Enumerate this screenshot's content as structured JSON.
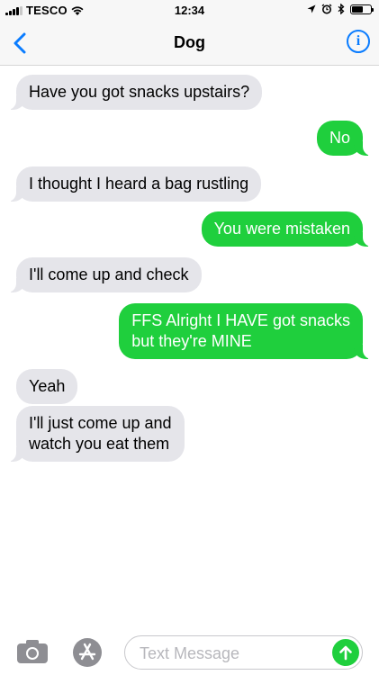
{
  "status_bar": {
    "carrier": "TESCO",
    "time": "12:34",
    "battery_level": 0.55
  },
  "nav": {
    "title": "Dog",
    "back_icon": "chevron-left-icon",
    "info_icon": "info-icon",
    "info_glyph": "i"
  },
  "colors": {
    "accent": "#0a7cff",
    "incoming_bubble": "#e5e5ea",
    "outgoing_bubble": "#1fcf3d"
  },
  "messages": [
    {
      "direction": "incoming",
      "text": "Have you got snacks upstairs?"
    },
    {
      "direction": "outgoing",
      "text": "No"
    },
    {
      "direction": "incoming",
      "text": "I thought I heard a bag rustling"
    },
    {
      "direction": "outgoing",
      "text": "You were mistaken"
    },
    {
      "direction": "incoming",
      "text": "I'll come up and check"
    },
    {
      "direction": "outgoing",
      "lines": [
        "FFS Alright I HAVE got snacks",
        "but they're MINE"
      ]
    },
    {
      "direction": "incoming",
      "text": "Yeah"
    },
    {
      "direction": "incoming",
      "lines": [
        "I'll just come up and",
        "watch you eat them"
      ]
    }
  ],
  "input_bar": {
    "placeholder": "Text Message",
    "value": "",
    "camera_icon": "camera-icon",
    "appstore_icon": "app-store-icon",
    "send_icon": "send-arrow-icon"
  }
}
